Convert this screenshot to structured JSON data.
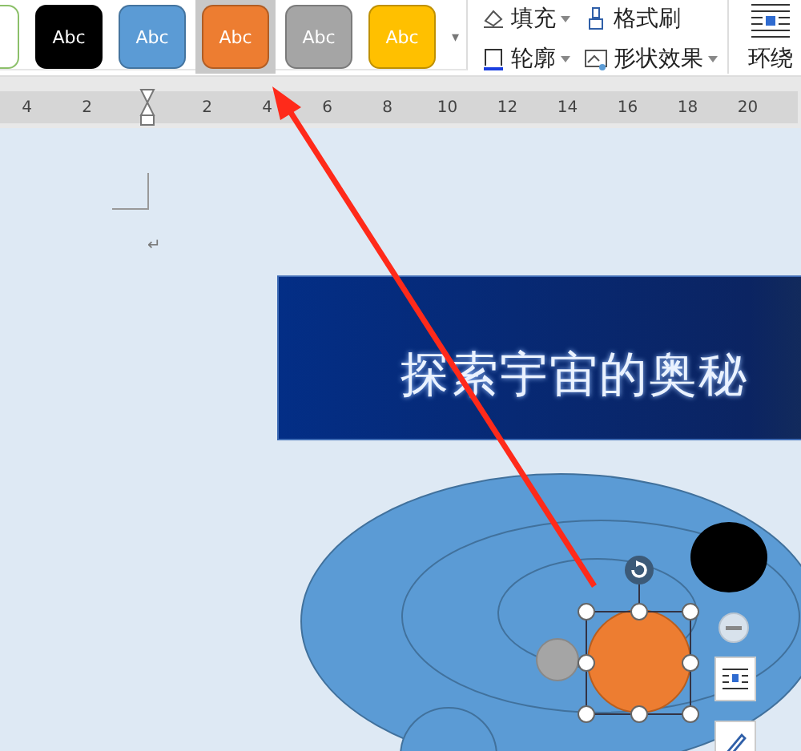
{
  "style_gallery": {
    "swatches": [
      {
        "label": "Abc",
        "color": "#000000",
        "selected": false
      },
      {
        "label": "Abc",
        "color": "#5b9bd5",
        "selected": false
      },
      {
        "label": "Abc",
        "color": "#ed7d31",
        "selected": true
      },
      {
        "label": "Abc",
        "color": "#a5a5a5",
        "selected": false
      },
      {
        "label": "Abc",
        "color": "#ffc000",
        "selected": false
      }
    ],
    "more": "▾"
  },
  "format_buttons": [
    {
      "kind": "fill",
      "label": "填充",
      "dropdown": true
    },
    {
      "kind": "painter",
      "label": "格式刷",
      "dropdown": false
    },
    {
      "kind": "outline",
      "label": "轮廓",
      "dropdown": true
    },
    {
      "kind": "effects",
      "label": "形状效果",
      "dropdown": true
    }
  ],
  "wrap_button": {
    "label": "环绕"
  },
  "ruler": {
    "marks": [
      {
        "kind": "number",
        "label": "4"
      },
      {
        "kind": "number",
        "label": "2"
      },
      {
        "kind": "indent"
      },
      {
        "kind": "number",
        "label": "2"
      },
      {
        "kind": "number",
        "label": "4"
      },
      {
        "kind": "number",
        "label": "6"
      },
      {
        "kind": "number",
        "label": "8"
      },
      {
        "kind": "number",
        "label": "10"
      },
      {
        "kind": "number",
        "label": "12"
      },
      {
        "kind": "number",
        "label": "14"
      },
      {
        "kind": "number",
        "label": "16"
      },
      {
        "kind": "number",
        "label": "18"
      },
      {
        "kind": "number",
        "label": "20"
      }
    ]
  },
  "document": {
    "paragraph_mark": "↵",
    "banner": {
      "title": "探索宇宙的奥秘"
    }
  }
}
